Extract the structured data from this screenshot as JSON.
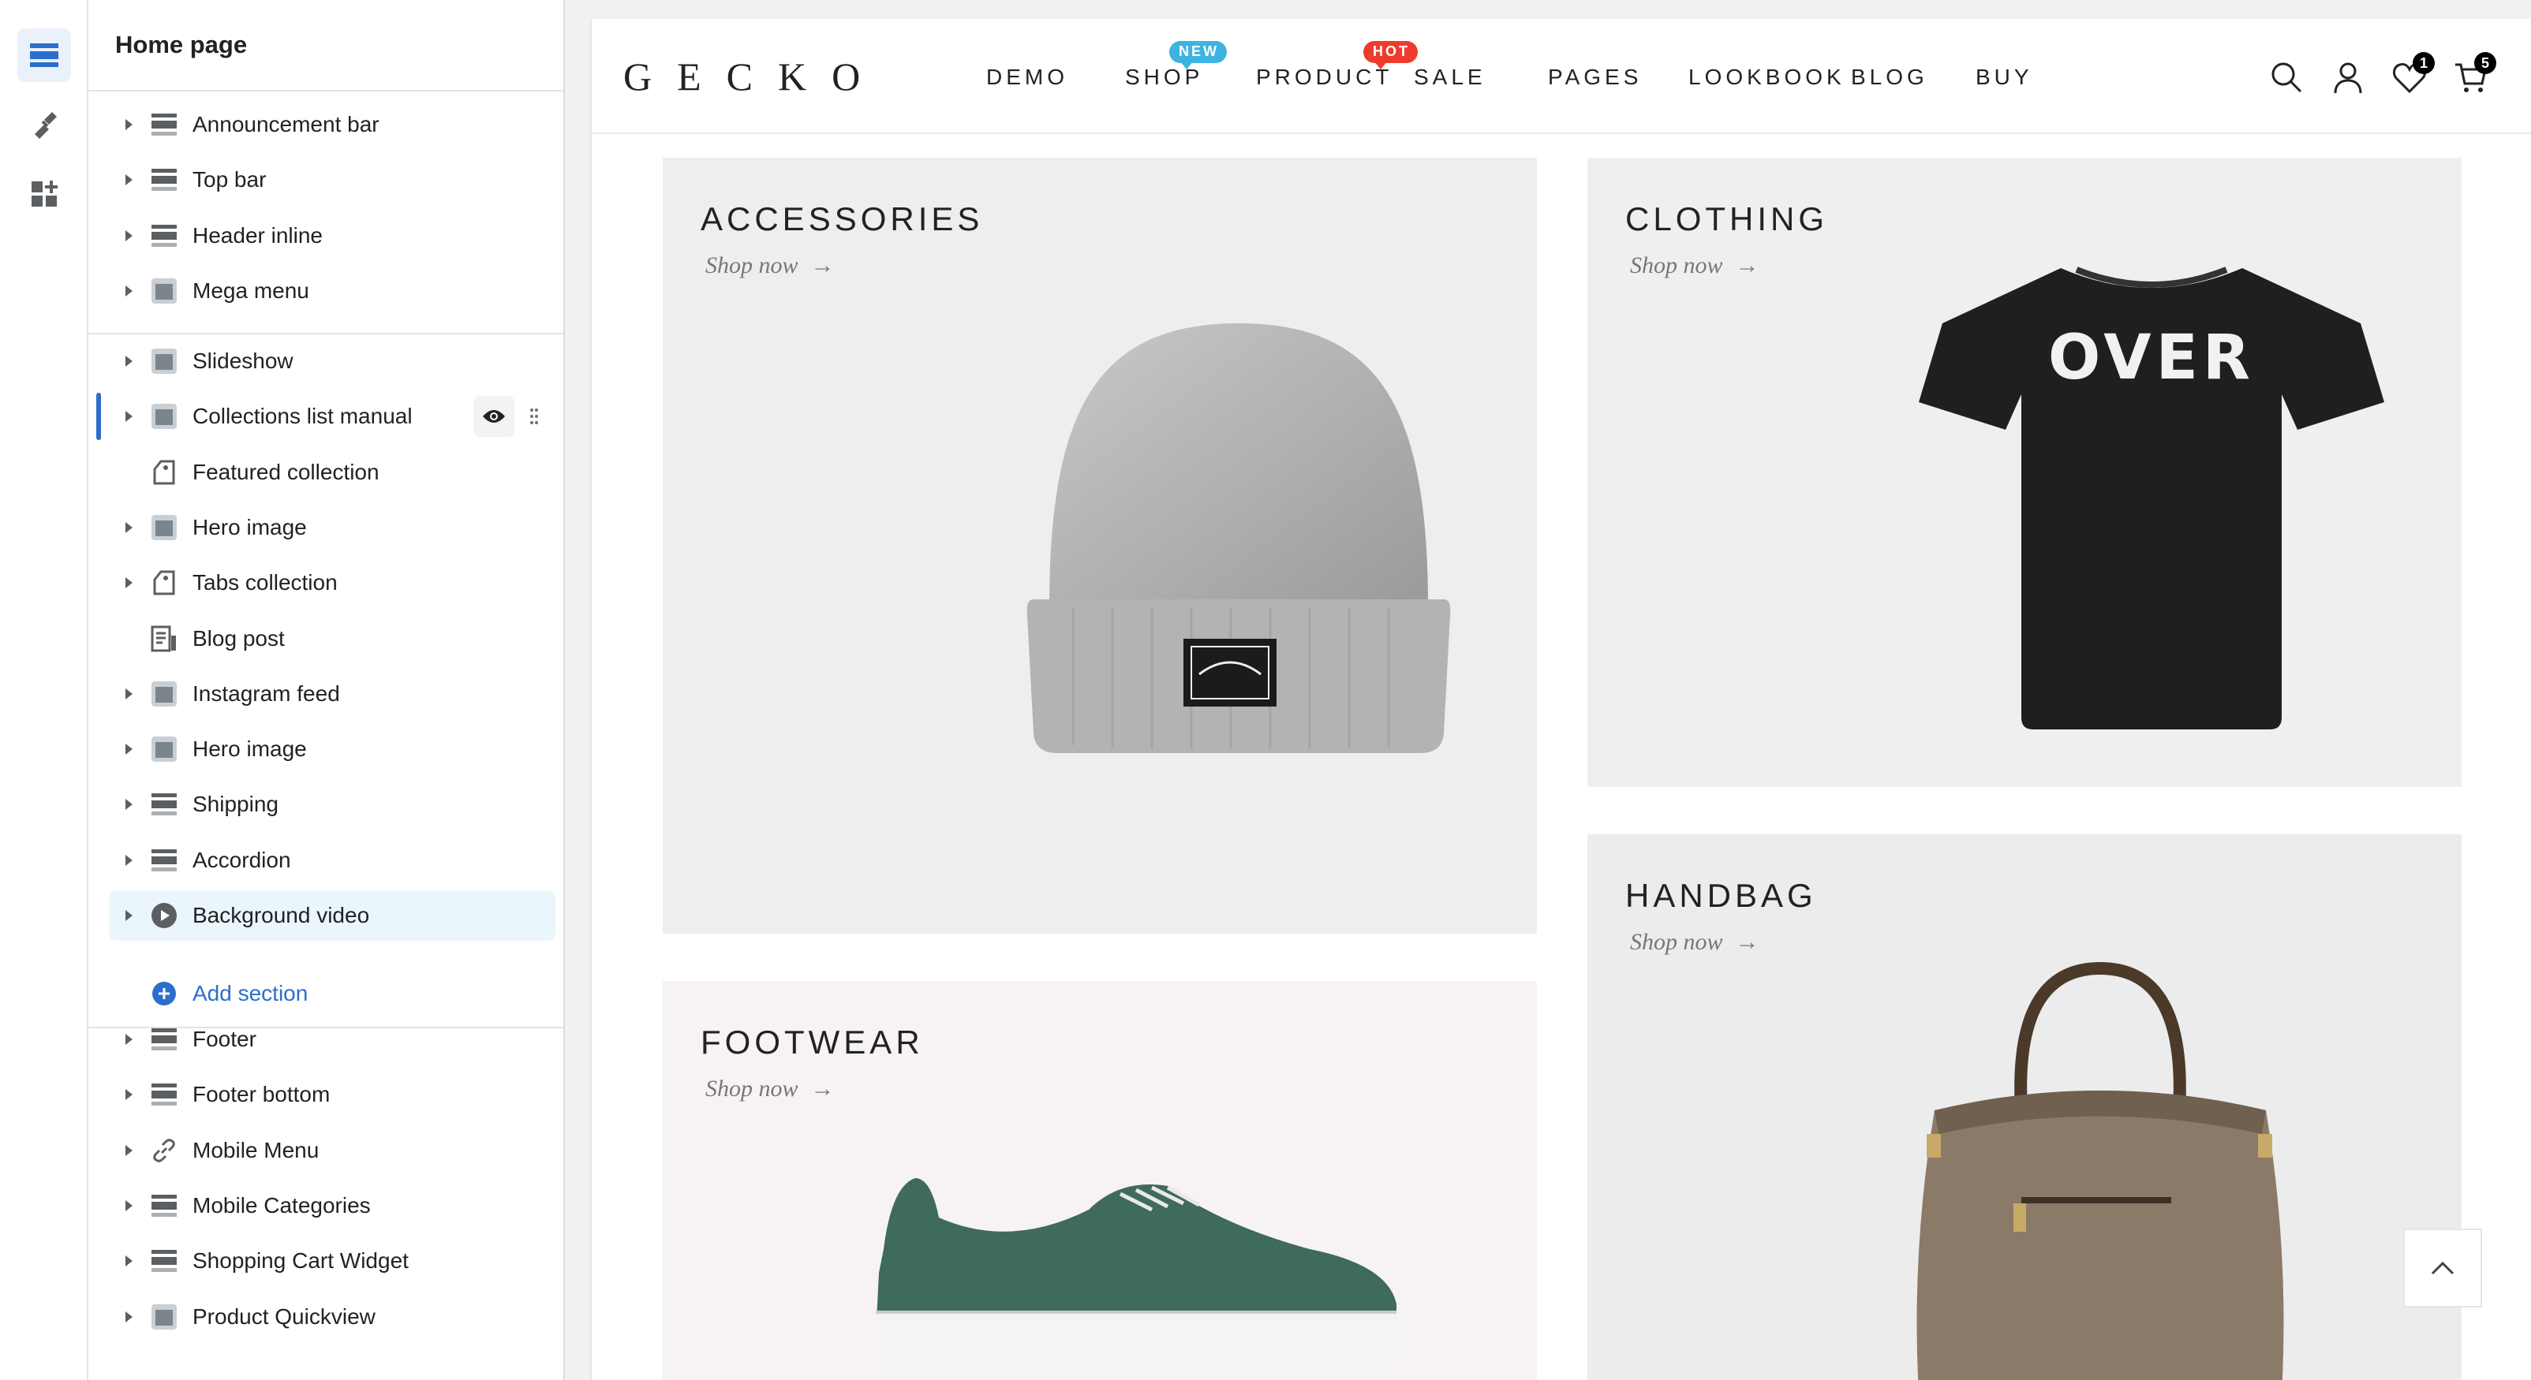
{
  "panel": {
    "title": "Home page"
  },
  "sections_header": [
    {
      "label": "Announcement bar",
      "icon": "section-layout-icon"
    },
    {
      "label": "Top bar",
      "icon": "section-layout-icon"
    },
    {
      "label": "Header inline",
      "icon": "section-layout-icon"
    },
    {
      "label": "Mega menu",
      "icon": "image-thumb-icon"
    }
  ],
  "sections_body": [
    {
      "label": "Slideshow",
      "icon": "image-thumb-icon"
    },
    {
      "label": "Collections list manual",
      "icon": "image-thumb-icon"
    },
    {
      "label": "Featured collection",
      "icon": "tag-icon"
    },
    {
      "label": "Hero image",
      "icon": "image-thumb-icon"
    },
    {
      "label": "Tabs collection",
      "icon": "tag-icon"
    },
    {
      "label": "Blog post",
      "icon": "blog-icon"
    },
    {
      "label": "Instagram feed",
      "icon": "image-thumb-icon"
    },
    {
      "label": "Hero image",
      "icon": "image-thumb-icon"
    },
    {
      "label": "Shipping",
      "icon": "section-layout-icon"
    },
    {
      "label": "Accordion",
      "icon": "section-layout-icon"
    },
    {
      "label": "Background video",
      "icon": "play-icon"
    }
  ],
  "add_section": "Add section",
  "sections_footer": [
    {
      "label": "Footer",
      "icon": "section-layout-icon"
    },
    {
      "label": "Footer bottom",
      "icon": "section-layout-icon"
    },
    {
      "label": "Mobile Menu",
      "icon": "link-icon"
    },
    {
      "label": "Mobile Categories",
      "icon": "section-layout-icon"
    },
    {
      "label": "Shopping Cart Widget",
      "icon": "section-layout-icon"
    },
    {
      "label": "Product Quickview",
      "icon": "image-thumb-icon"
    }
  ],
  "store": {
    "logo": "GECKO",
    "nav": [
      "DEMO",
      "SHOP",
      "PRODUCT",
      "SALE",
      "PAGES",
      "LOOKBOOK",
      "BLOG",
      "BUY"
    ],
    "badges": {
      "shop": "NEW",
      "product": "HOT"
    },
    "wishlist_count": "1",
    "cart_count": "5"
  },
  "collections": [
    {
      "title": "ACCESSORIES",
      "link": "Shop now"
    },
    {
      "title": "CLOTHING",
      "link": "Shop now",
      "print": "OVER"
    },
    {
      "title": "HANDBAG",
      "link": "Shop now"
    },
    {
      "title": "FOOTWEAR",
      "link": "Shop now"
    }
  ],
  "colors": {
    "accent": "#2c6ecb",
    "badge_new": "#3db3e0",
    "badge_hot": "#ef3b2d",
    "fab": "#2e7d56"
  }
}
